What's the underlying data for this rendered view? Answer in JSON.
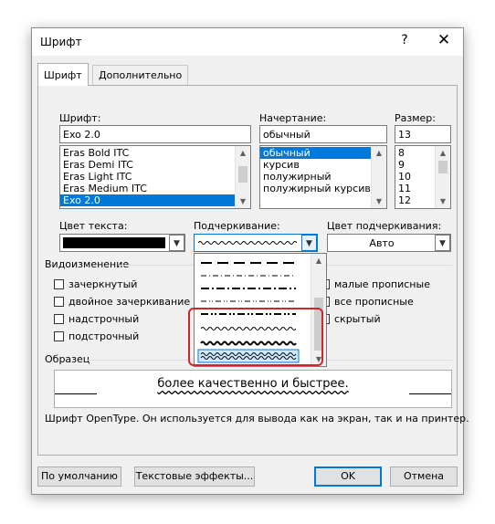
{
  "dialog": {
    "title": "Шрифт",
    "help": "?",
    "close": "✕",
    "tabs": [
      {
        "label": "Шрифт",
        "active": true
      },
      {
        "label": "Дополнительно",
        "active": false
      }
    ]
  },
  "font": {
    "label": "Шрифт:",
    "value": "Exo 2.0",
    "items": [
      "Eras Bold ITC",
      "Eras Demi ITC",
      "Eras Light ITC",
      "Eras Medium ITC",
      "Exo 2.0"
    ],
    "selected": "Exo 2.0"
  },
  "style": {
    "label": "Начертание:",
    "value": "обычный",
    "items": [
      "обычный",
      "курсив",
      "полужирный",
      "полужирный курсив"
    ],
    "selected": "обычный"
  },
  "size": {
    "label": "Размер:",
    "value": "13",
    "items": [
      "8",
      "9",
      "10",
      "11",
      "12"
    ]
  },
  "text_color": {
    "label": "Цвет текста:",
    "color": "#000000"
  },
  "underline": {
    "label": "Подчеркивание:",
    "options_visible": 7
  },
  "underline_color": {
    "label": "Цвет подчеркивания:",
    "value": "Авто"
  },
  "effects": {
    "label": "Видоизменение",
    "left": [
      "зачеркнутый",
      "двойное зачеркивание",
      "надстрочный",
      "подстрочный"
    ],
    "right": [
      "малые прописные",
      "все прописные",
      "скрытый"
    ]
  },
  "sample": {
    "label": "Образец",
    "text": "более качественно и быстрее.",
    "note": "Шрифт OpenType. Он используется для вывода как на экран, так и на принтер."
  },
  "buttons": {
    "default": "По умолчанию",
    "text_effects": "Текстовые эффекты...",
    "ok": "OK",
    "cancel": "Отмена"
  },
  "accent": "#0078d7",
  "highlight_box": "#d0252a"
}
